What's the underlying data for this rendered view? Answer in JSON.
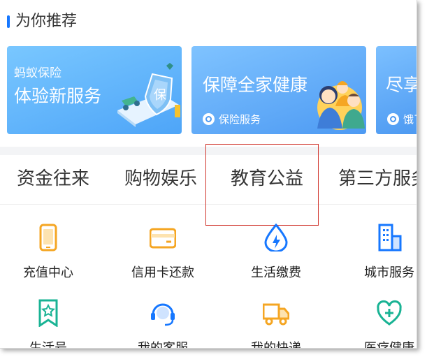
{
  "section": {
    "title": "为你推荐"
  },
  "cards": [
    {
      "subtitle": "蚂蚁保险",
      "title": "体验新服务",
      "badge": "保"
    },
    {
      "title": "保障全家健康",
      "footer": "保险服务"
    },
    {
      "title": "尽享",
      "footer": "饿了"
    }
  ],
  "tabs": [
    "资金往来",
    "购物娱乐",
    "教育公益",
    "第三方服务"
  ],
  "services": [
    {
      "label": "充值中心",
      "icon": "phone-icon",
      "color": "#f5a623"
    },
    {
      "label": "信用卡还款",
      "icon": "credit-card-icon",
      "color": "#f5a623"
    },
    {
      "label": "生活缴费",
      "icon": "water-drop-bolt-icon",
      "color": "#1677ff"
    },
    {
      "label": "城市服务",
      "icon": "city-building-icon",
      "color": "#1677ff"
    },
    {
      "label": "生活号",
      "icon": "bookmark-star-icon",
      "color": "#19b394"
    },
    {
      "label": "我的客服",
      "icon": "headset-icon",
      "color": "#1677ff"
    },
    {
      "label": "我的快递",
      "icon": "delivery-truck-icon",
      "color": "#f5a623"
    },
    {
      "label": "医疗健康",
      "icon": "heart-plus-icon",
      "color": "#19b394"
    }
  ]
}
